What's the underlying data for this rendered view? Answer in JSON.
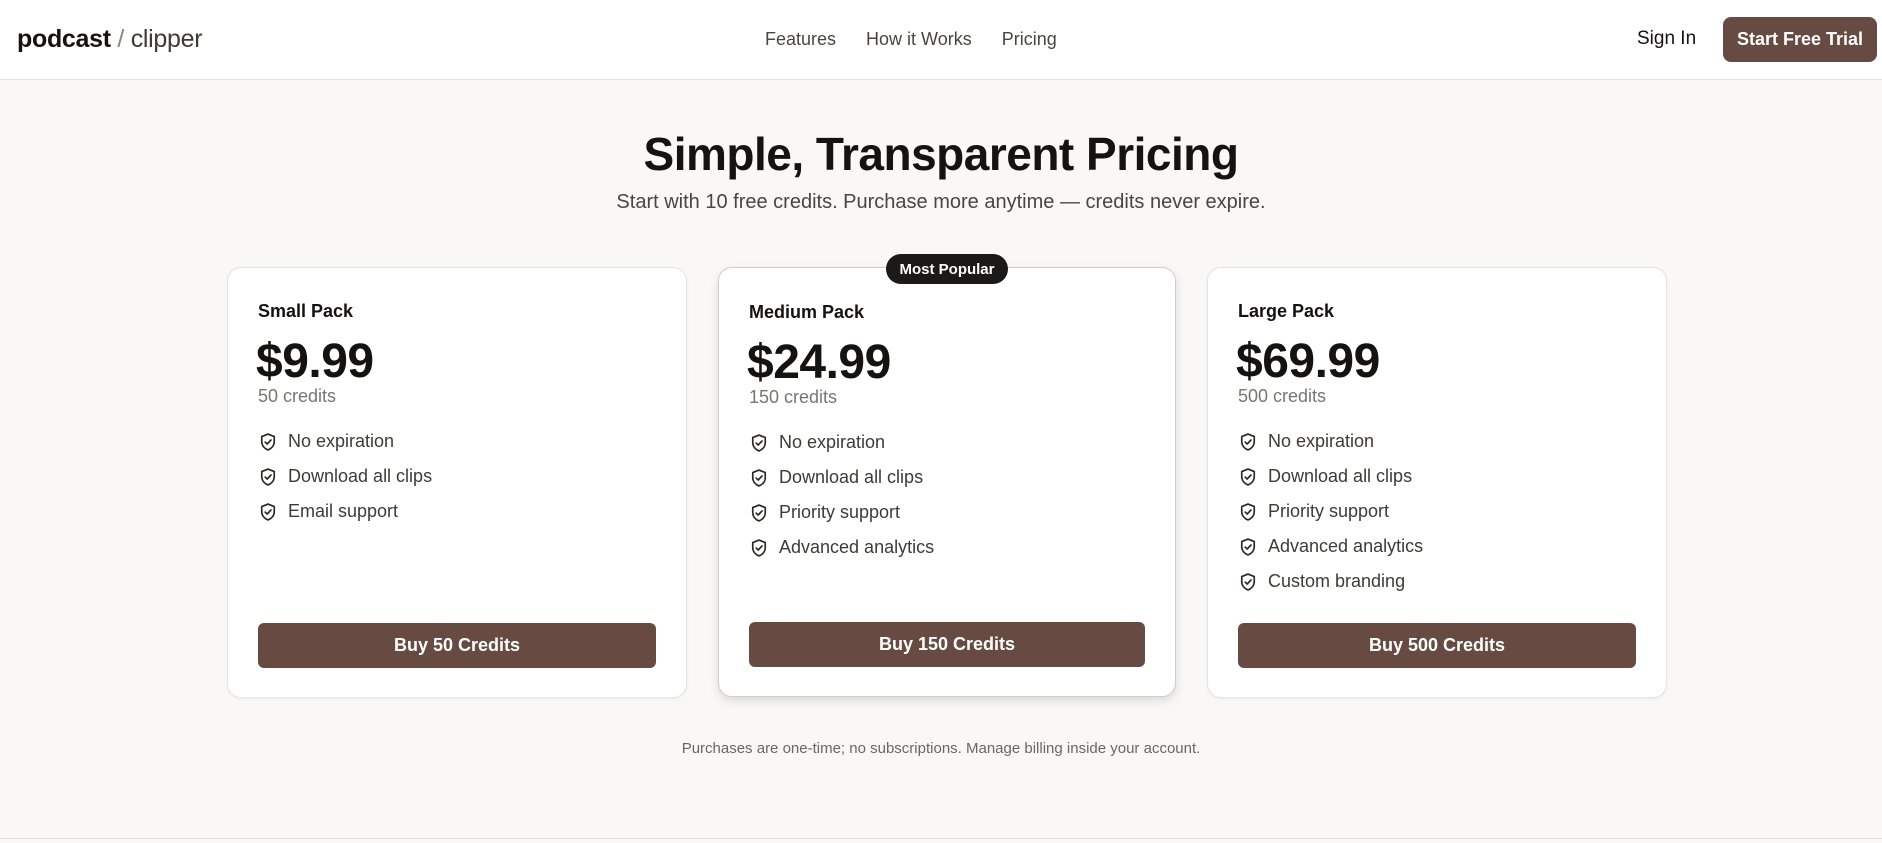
{
  "header": {
    "logo_bold": "podcast",
    "logo_sep": " / ",
    "logo_light": "clipper",
    "nav": [
      "Features",
      "How it Works",
      "Pricing"
    ],
    "signin": "Sign In",
    "trial": "Start Free Trial"
  },
  "hero": {
    "title": "Simple, Transparent Pricing",
    "subtitle": "Start with 10 free credits. Purchase more anytime — credits never expire."
  },
  "badge": "Most Popular",
  "plans": [
    {
      "name": "Small Pack",
      "price": "$9.99",
      "credits": "50 credits",
      "features": [
        "No expiration",
        "Download all clips",
        "Email support"
      ],
      "button": "Buy 50 Credits"
    },
    {
      "name": "Medium Pack",
      "price": "$24.99",
      "credits": "150 credits",
      "features": [
        "No expiration",
        "Download all clips",
        "Priority support",
        "Advanced analytics"
      ],
      "button": "Buy 150 Credits"
    },
    {
      "name": "Large Pack",
      "price": "$69.99",
      "credits": "500 credits",
      "features": [
        "No expiration",
        "Download all clips",
        "Priority support",
        "Advanced analytics",
        "Custom branding"
      ],
      "button": "Buy 500 Credits"
    }
  ],
  "note": "Purchases are one-time; no subscriptions. Manage billing inside your account.",
  "colors": {
    "accent": "#674b43",
    "badge": "#1c1a19",
    "background": "#f9f8f7"
  },
  "icons": {
    "feature": "shield-check-icon"
  }
}
